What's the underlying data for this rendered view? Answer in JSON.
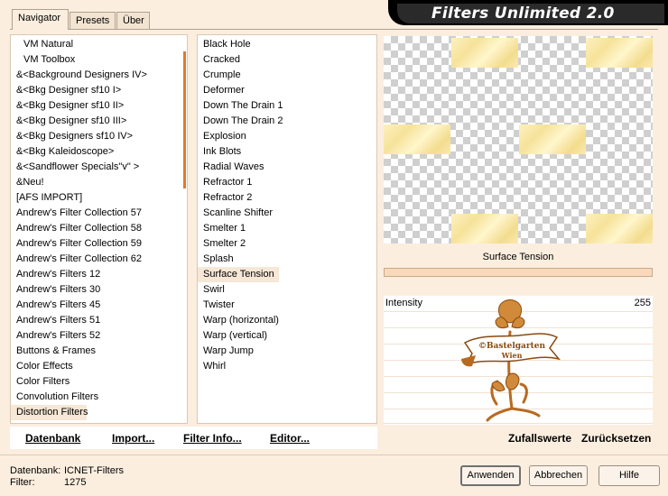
{
  "tabs": [
    {
      "label": "Navigator",
      "active": true
    },
    {
      "label": "Presets",
      "active": false
    },
    {
      "label": "Über",
      "active": false
    }
  ],
  "banner_title": "Filters Unlimited 2.0",
  "categories": [
    "VM Natural",
    "VM Toolbox",
    "&<Background Designers IV>",
    "&<Bkg Designer sf10 I>",
    "&<Bkg Designer sf10 II>",
    "&<Bkg Designer sf10 III>",
    "&<Bkg Designers sf10 IV>",
    "&<Bkg Kaleidoscope>",
    "&<Sandflower Specials\"v\" >",
    "&Neu!",
    "[AFS IMPORT]",
    "Andrew's Filter Collection 57",
    "Andrew's Filter Collection 58",
    "Andrew's Filter Collection 59",
    "Andrew's Filter Collection 62",
    "Andrew's Filters 12",
    "Andrew's Filters 30",
    "Andrew's Filters 45",
    "Andrew's Filters 51",
    "Andrew's Filters 52",
    "Buttons & Frames",
    "Color Effects",
    "Color Filters",
    "Convolution Filters",
    "Distortion Filters"
  ],
  "selected_category": "Distortion Filters",
  "filters": [
    "Black Hole",
    "Cracked",
    "Crumple",
    "Deformer",
    "Down The Drain 1",
    "Down The Drain 2",
    "Explosion",
    "Ink Blots",
    "Radial Waves",
    "Refractor 1",
    "Refractor 2",
    "Scanline Shifter",
    "Smelter 1",
    "Smelter 2",
    "Splash",
    "Surface Tension",
    "Swirl",
    "Twister",
    "Warp (horizontal)",
    "Warp (vertical)",
    "Warp Jump",
    "Whirl"
  ],
  "selected_filter": "Surface Tension",
  "preview": {
    "filter_name": "Surface Tension"
  },
  "param": {
    "label": "Intensity",
    "value": "255"
  },
  "watermark": {
    "line1": "©Bastelgarten",
    "line2": "Wien"
  },
  "left_buttons": {
    "database": "Datenbank",
    "import": "Import...",
    "filter_info": "Filter Info...",
    "editor": "Editor..."
  },
  "right_buttons": {
    "random": "Zufallswerte",
    "reset": "Zurücksetzen"
  },
  "info": {
    "database_label": "Datenbank:",
    "database_value": "ICNET-Filters",
    "filter_label": "Filter:",
    "filter_value": "1275"
  },
  "footer_buttons": {
    "apply": "Anwenden",
    "cancel": "Abbrechen",
    "help": "Hilfe"
  },
  "colors": {
    "window_bg": "#fbeedf",
    "accent_orange": "#e07a2a",
    "watermark": "#b86a20",
    "slider": "#f8d9bb"
  }
}
